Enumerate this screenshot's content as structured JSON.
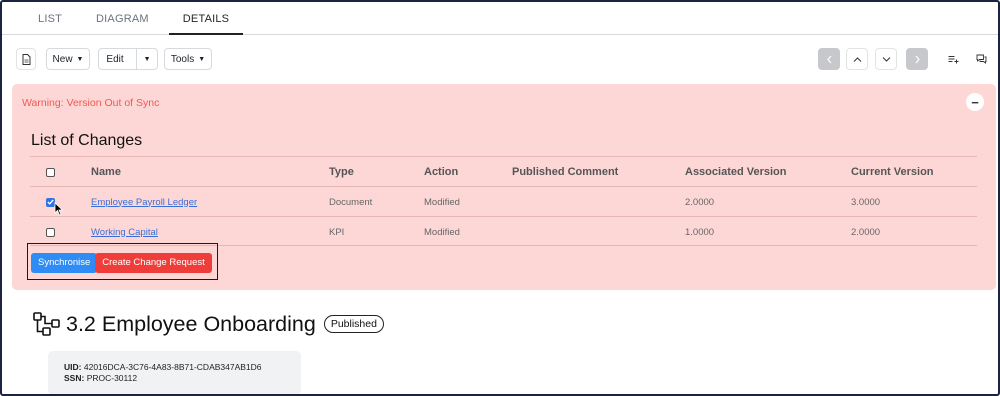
{
  "tabs": [
    {
      "label": "LIST",
      "active": false
    },
    {
      "label": "DIAGRAM",
      "active": false
    },
    {
      "label": "DETAILS",
      "active": true
    }
  ],
  "toolbar": {
    "document_icon": "document-icon",
    "new_label": "New",
    "edit_label": "Edit",
    "tools_label": "Tools",
    "right_icons": [
      "chevron-left-icon",
      "chevron-up-icon",
      "chevron-down-icon",
      "chevron-right-icon",
      "add-list-icon",
      "comments-icon"
    ]
  },
  "warning": {
    "title": "Warning: Version Out of Sync",
    "collapse_symbol": "−",
    "list_title": "List of Changes",
    "columns": [
      "Name",
      "Type",
      "Action",
      "Published Comment",
      "Associated Version",
      "Current Version"
    ],
    "rows": [
      {
        "checked": true,
        "name": "Employee Payroll Ledger",
        "type": "Document",
        "action": "Modified",
        "comment": "",
        "associated": "2.0000",
        "current": "3.0000"
      },
      {
        "checked": false,
        "name": "Working Capital",
        "type": "KPI",
        "action": "Modified",
        "comment": "",
        "associated": "1.0000",
        "current": "2.0000"
      }
    ],
    "synchronise_label": "Synchronise",
    "change_request_label": "Create Change Request"
  },
  "page": {
    "title": "3.2 Employee Onboarding",
    "status": "Published",
    "uid_label": "UID:",
    "uid": "42016DCA-3C76-4A83-8B71-CDAB347AB1D6",
    "ssn_label": "SSN:",
    "ssn": "PROC-30112"
  },
  "colors": {
    "warning_bg": "#fdd7d6",
    "warning_text": "#ee5a52",
    "primary": "#2f8cf4",
    "danger": "#ef3e3a",
    "link": "#3b6fd6"
  }
}
